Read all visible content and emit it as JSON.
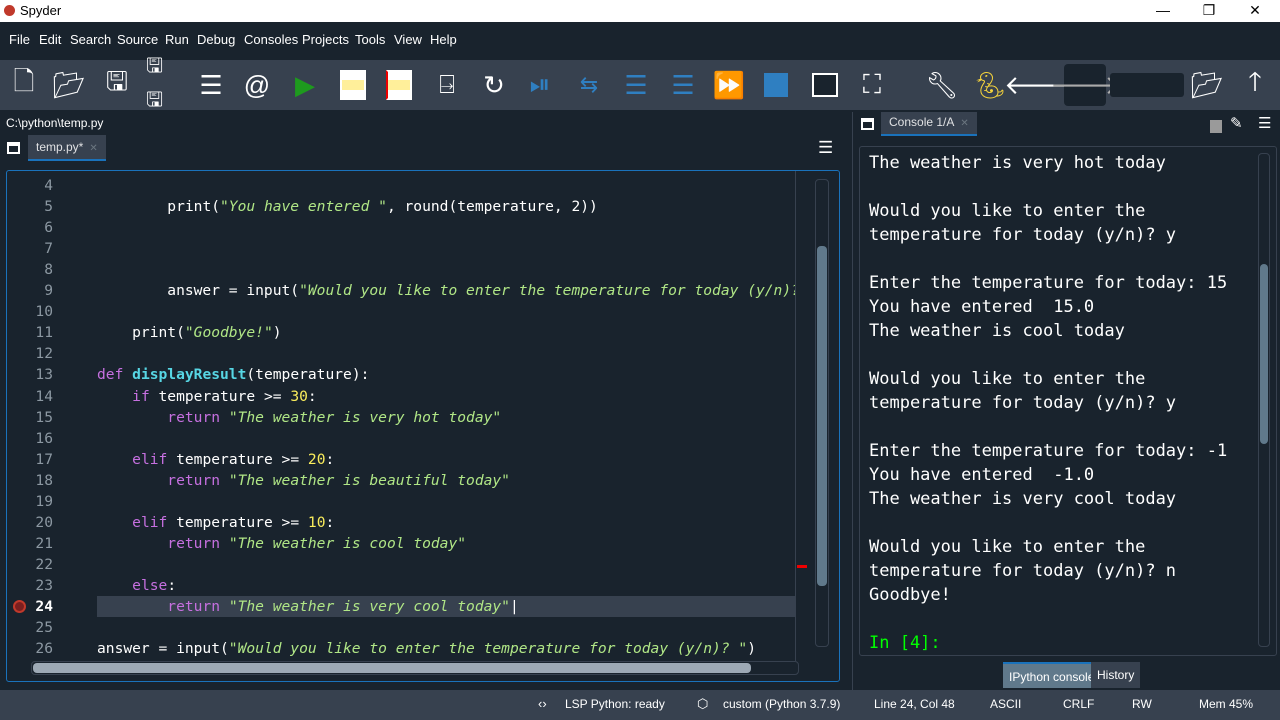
{
  "window": {
    "title": "Spyder",
    "minimize": "—",
    "restore": "❐",
    "close": "✕"
  },
  "menu": [
    "File",
    "Edit",
    "Search",
    "Source",
    "Run",
    "Debug",
    "Consoles",
    "Projects",
    "Tools",
    "View",
    "Help"
  ],
  "toolbar": {
    "icons": [
      "new-file-icon",
      "open-file-icon",
      "save-icon",
      "save-all-icon",
      "outline-icon",
      "at-icon",
      "run-icon",
      "run-cell-icon",
      "run-cell-advance-icon",
      "run-selection-icon",
      "re-run-icon",
      "debug-icon",
      "step-icon",
      "step-into-icon",
      "step-return-icon",
      "continue-icon",
      "stop-icon",
      "maximize-pane-icon",
      "fullscreen-icon",
      "preferences-icon",
      "python-path-icon",
      "back-icon",
      "forward-icon",
      "browse-folder-icon",
      "parent-dir-icon"
    ],
    "working_dir": ""
  },
  "editor": {
    "path": "C:\\python\\temp.py",
    "tab": "temp.py*",
    "line_numbers": [
      "4",
      "5",
      "6",
      "7",
      "8",
      "9",
      "10",
      "11",
      "12",
      "13",
      "14",
      "15",
      "16",
      "17",
      "18",
      "19",
      "20",
      "21",
      "22",
      "23",
      "24",
      "25",
      "26"
    ],
    "current_line": "24",
    "lines": [
      [],
      [
        [
          "tx",
          "        "
        ],
        [
          "tx",
          "print("
        ],
        [
          "st",
          "\"You have entered \""
        ],
        [
          "tx",
          ", round(temperature, 2))"
        ]
      ],
      [],
      [],
      [],
      [
        [
          "tx",
          "        answer = input("
        ],
        [
          "st",
          "\"Would you like to enter the temperature for today (y/n)? \""
        ],
        [
          "tx",
          ")"
        ]
      ],
      [],
      [
        [
          "tx",
          "    print("
        ],
        [
          "st",
          "\"Goodbye!\""
        ],
        [
          "tx",
          ")"
        ]
      ],
      [],
      [
        [
          "kw",
          "def "
        ],
        [
          "fn",
          "displayResult"
        ],
        [
          "tx",
          "(temperature):"
        ]
      ],
      [
        [
          "tx",
          "    "
        ],
        [
          "kw",
          "if"
        ],
        [
          "tx",
          " temperature >= "
        ],
        [
          "nu",
          "30"
        ],
        [
          "tx",
          ":"
        ]
      ],
      [
        [
          "tx",
          "        "
        ],
        [
          "kw",
          "return "
        ],
        [
          "st",
          "\"The weather is very hot today\""
        ]
      ],
      [],
      [
        [
          "tx",
          "    "
        ],
        [
          "kw",
          "elif"
        ],
        [
          "tx",
          " temperature >= "
        ],
        [
          "nu",
          "20"
        ],
        [
          "tx",
          ":"
        ]
      ],
      [
        [
          "tx",
          "        "
        ],
        [
          "kw",
          "return "
        ],
        [
          "st",
          "\"The weather is beautiful today\""
        ]
      ],
      [],
      [
        [
          "tx",
          "    "
        ],
        [
          "kw",
          "elif"
        ],
        [
          "tx",
          " temperature >= "
        ],
        [
          "nu",
          "10"
        ],
        [
          "tx",
          ":"
        ]
      ],
      [
        [
          "tx",
          "        "
        ],
        [
          "kw",
          "return "
        ],
        [
          "st",
          "\"The weather is cool today\""
        ]
      ],
      [],
      [
        [
          "tx",
          "    "
        ],
        [
          "kw",
          "else"
        ],
        [
          "tx",
          ":"
        ]
      ],
      [
        [
          "tx",
          "        "
        ],
        [
          "kw",
          "return "
        ],
        [
          "st",
          "\"The weather is very cool today\""
        ],
        [
          "tx",
          "|"
        ]
      ],
      [],
      [
        [
          "tx",
          "answer = input("
        ],
        [
          "st",
          "\"Would you like to enter the temperature for today (y/n)? \""
        ],
        [
          "tx",
          ")"
        ]
      ]
    ]
  },
  "console": {
    "tab": "Console 1/A",
    "lines": [
      "The weather is very hot today",
      "",
      "Would you like to enter the",
      "temperature for today (y/n)? y",
      "",
      "Enter the temperature for today: 15",
      "You have entered  15.0",
      "The weather is cool today",
      "",
      "Would you like to enter the",
      "temperature for today (y/n)? y",
      "",
      "Enter the temperature for today: -1",
      "You have entered  -1.0",
      "The weather is very cool today",
      "",
      "Would you like to enter the",
      "temperature for today (y/n)? n",
      "Goodbye!",
      ""
    ],
    "prompt": "In [4]:",
    "bottom_tabs": [
      "IPython console",
      "History"
    ]
  },
  "status": {
    "lsp": "LSP Python: ready",
    "env": "custom (Python 3.7.9)",
    "position": "Line 24, Col 48",
    "encoding": "ASCII",
    "eol": "CRLF",
    "rw": "RW",
    "mem": "Mem 45%"
  },
  "colors": {
    "bg": "#19232d",
    "panel": "#37414f",
    "accent": "#1a72bb",
    "keyword": "#c670e0",
    "function": "#57d6e4",
    "string": "#b0e686",
    "number": "#faed5c"
  }
}
